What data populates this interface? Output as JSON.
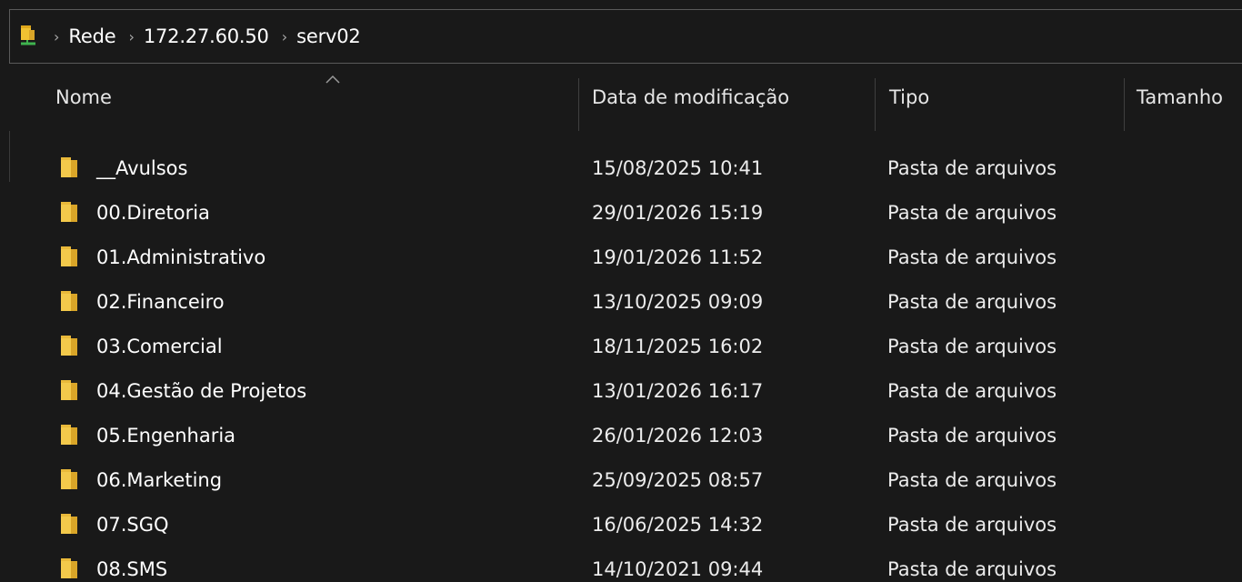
{
  "breadcrumb": {
    "icon": "network-location-icon",
    "items": [
      "Rede",
      "172.27.60.50",
      "serv02"
    ],
    "separator": "›"
  },
  "columns": {
    "name": "Nome",
    "date": "Data de modificação",
    "type": "Tipo",
    "size": "Tamanho"
  },
  "sort": {
    "column": "name",
    "direction": "ascending"
  },
  "rows": [
    {
      "name": "__Avulsos",
      "date": "15/08/2025 10:41",
      "type": "Pasta de arquivos"
    },
    {
      "name": "00.Diretoria",
      "date": "29/01/2026 15:19",
      "type": "Pasta de arquivos"
    },
    {
      "name": "01.Administrativo",
      "date": "19/01/2026 11:52",
      "type": "Pasta de arquivos"
    },
    {
      "name": "02.Financeiro",
      "date": "13/10/2025 09:09",
      "type": "Pasta de arquivos"
    },
    {
      "name": "03.Comercial",
      "date": "18/11/2025 16:02",
      "type": "Pasta de arquivos"
    },
    {
      "name": "04.Gestão de Projetos",
      "date": "13/01/2026 16:17",
      "type": "Pasta de arquivos"
    },
    {
      "name": "05.Engenharia",
      "date": "26/01/2026 12:03",
      "type": "Pasta de arquivos"
    },
    {
      "name": "06.Marketing",
      "date": "25/09/2025 08:57",
      "type": "Pasta de arquivos"
    },
    {
      "name": "07.SGQ",
      "date": "16/06/2025 14:32",
      "type": "Pasta de arquivos"
    },
    {
      "name": "08.SMS",
      "date": "14/10/2021 09:44",
      "type": "Pasta de arquivos"
    }
  ],
  "colors": {
    "background": "#191919",
    "folder": "#f3c94b",
    "folder_dark": "#d9a528",
    "text": "#ffffff",
    "border": "#5a5a5a"
  }
}
